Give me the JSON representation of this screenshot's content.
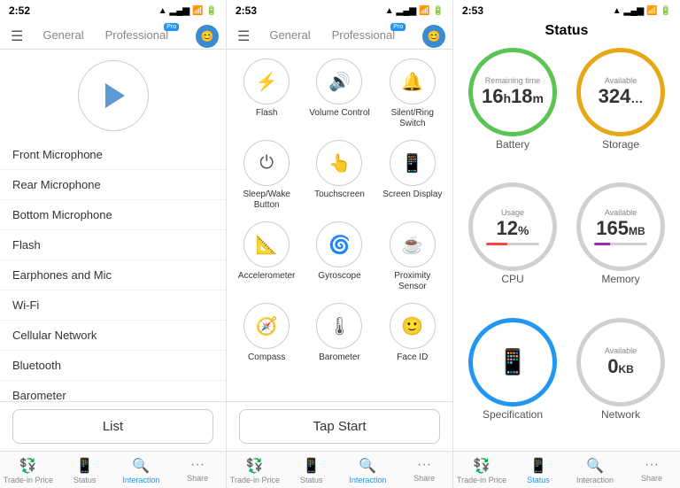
{
  "panel1": {
    "statusBar": {
      "time": "2:52",
      "arrow": "▲"
    },
    "tabs": [
      {
        "label": "General",
        "active": false
      },
      {
        "label": "Professional",
        "active": false,
        "pro": true
      }
    ],
    "listItems": [
      "Front Microphone",
      "Rear Microphone",
      "Bottom Microphone",
      "Flash",
      "Earphones and Mic",
      "Wi-Fi",
      "Cellular Network",
      "Bluetooth",
      "Barometer"
    ],
    "listButton": "List",
    "navItems": [
      {
        "label": "Trade-in Price",
        "icon": "💱",
        "active": false
      },
      {
        "label": "Status",
        "icon": "📱",
        "active": false
      },
      {
        "label": "Interaction",
        "icon": "🔍",
        "active": true
      },
      {
        "label": "Share",
        "icon": "···",
        "active": false
      }
    ]
  },
  "panel2": {
    "statusBar": {
      "time": "2:53"
    },
    "iconRows": [
      [
        {
          "label": "Flash",
          "icon": "⚡"
        },
        {
          "label": "Volume Control",
          "icon": "🔊"
        },
        {
          "label": "Silent/Ring Switch",
          "icon": "🔔"
        }
      ],
      [
        {
          "label": "Sleep/Wake Button",
          "icon": "⏻"
        },
        {
          "label": "Touchscreen",
          "icon": "👆"
        },
        {
          "label": "Screen Display",
          "icon": "📱"
        }
      ],
      [
        {
          "label": "Accelerometer",
          "icon": "📐"
        },
        {
          "label": "Gyroscope",
          "icon": "🌀"
        },
        {
          "label": "Proximity Sensor",
          "icon": "☕"
        }
      ],
      [
        {
          "label": "Compass",
          "icon": "🧭"
        },
        {
          "label": "Barometer",
          "icon": "🌡"
        },
        {
          "label": "Face ID",
          "icon": "🙂"
        }
      ]
    ],
    "tapButton": "Tap Start",
    "navItems": [
      {
        "label": "Trade-in Price",
        "active": false
      },
      {
        "label": "Status",
        "active": false
      },
      {
        "label": "Interaction",
        "active": true
      },
      {
        "label": "Share",
        "active": false
      }
    ]
  },
  "panel3": {
    "statusBar": {
      "time": "2:53"
    },
    "title": "Status",
    "stats": [
      {
        "id": "battery",
        "labelTop": "Remaining time",
        "mainValue": "16",
        "unit": "h",
        "subValue": "18m",
        "labelBottom": "Battery",
        "color": "battery"
      },
      {
        "id": "storage",
        "labelTop": "Available",
        "mainValue": "324",
        "unit": "...",
        "labelBottom": "Storage",
        "color": "storage"
      },
      {
        "id": "cpu",
        "labelTop": "Usage",
        "mainValue": "12",
        "unit": "%",
        "labelBottom": "CPU",
        "color": "cpu",
        "bar": "cpu-bar"
      },
      {
        "id": "memory",
        "labelTop": "Available",
        "mainValue": "165",
        "unit": "MB",
        "labelBottom": "Memory",
        "color": "memory",
        "bar": "mem-bar"
      },
      {
        "id": "spec",
        "labelBottom": "Specification",
        "color": "spec",
        "isSpec": true
      },
      {
        "id": "network",
        "labelTop": "Available",
        "mainValue": "0",
        "unit": "KB",
        "labelBottom": "Network",
        "color": "network"
      }
    ],
    "navItems": [
      {
        "label": "Trade-in Price",
        "active": false
      },
      {
        "label": "Status",
        "active": true
      },
      {
        "label": "Interaction",
        "active": false
      },
      {
        "label": "Share",
        "active": false
      }
    ]
  }
}
